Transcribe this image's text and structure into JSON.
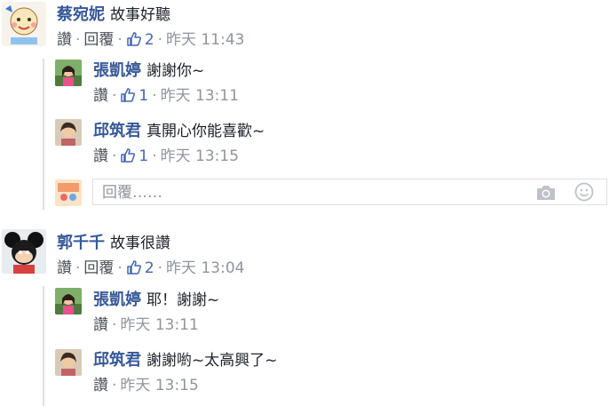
{
  "comments": [
    {
      "author": "蔡宛妮",
      "text": "故事好聽",
      "actions": {
        "like": "讚",
        "reply": "回覆"
      },
      "like_count": "2",
      "time_day": "昨天",
      "time": "11:43",
      "replies": [
        {
          "author": "張凱婷",
          "text": "謝謝你~",
          "like": "讚",
          "like_count": "1",
          "time_day": "昨天",
          "time": "13:11"
        },
        {
          "author": "邱筑君",
          "text": "真開心你能喜歡~",
          "like": "讚",
          "like_count": "1",
          "time_day": "昨天",
          "time": "13:15"
        }
      ],
      "reply_input": {
        "placeholder": "回覆……"
      }
    },
    {
      "author": "郭千千",
      "text": "故事很讚",
      "actions": {
        "like": "讚",
        "reply": "回覆"
      },
      "like_count": "2",
      "time_day": "昨天",
      "time": "13:04",
      "replies": [
        {
          "author": "張凱婷",
          "text": "耶！謝謝~",
          "like": "讚",
          "time_day": "昨天",
          "time": "13:11"
        },
        {
          "author": "邱筑君",
          "text": "謝謝喲~太高興了~",
          "like": "讚",
          "time_day": "昨天",
          "time": "13:15"
        }
      ]
    }
  ],
  "icons": {
    "like": "thumbs-up-icon",
    "camera": "camera-icon",
    "emoji": "smiley-icon"
  },
  "colors": {
    "name_link": "#365899",
    "like_blue": "#4267b2",
    "muted": "#90949c",
    "thread_line": "#dddfe2"
  }
}
